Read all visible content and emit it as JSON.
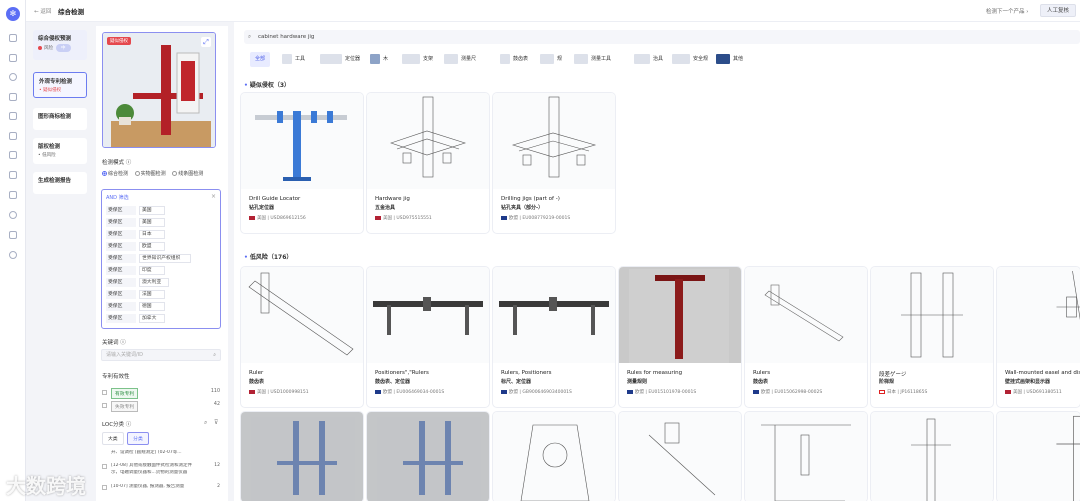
{
  "header": {
    "back_label": "← 返回",
    "title": "综合检测",
    "next_label": "检测下一个产品 ›",
    "manual_label": "人工复核"
  },
  "steps": [
    {
      "title": "综合侵权预测",
      "sub": "风险",
      "badge": "中"
    },
    {
      "title": "外观专利检测",
      "sub": "• 疑似侵权"
    },
    {
      "title": "图形商标检测",
      "sub": ""
    },
    {
      "title": "版权检测",
      "sub": "• 低风险"
    },
    {
      "title": "生成检测报告",
      "sub": ""
    }
  ],
  "panel": {
    "preview_tag": "疑似侵权",
    "mode_label": "检测模式 ⓘ",
    "modes": [
      "综合检测",
      "实物图检测",
      "线条图检测"
    ],
    "and_header": "AND 筛选",
    "filters": [
      {
        "k": "受保区",
        "v": "美国"
      },
      {
        "k": "受保区",
        "v": "美国"
      },
      {
        "k": "受保区",
        "v": "日本"
      },
      {
        "k": "受保区",
        "v": "欧盟"
      },
      {
        "k": "受保区",
        "v": "世界知识产权组织"
      },
      {
        "k": "受保区",
        "v": "印度"
      },
      {
        "k": "受保区",
        "v": "澳大利亚"
      },
      {
        "k": "受保区",
        "v": "法国"
      },
      {
        "k": "受保区",
        "v": "德国"
      },
      {
        "k": "受保区",
        "v": "加拿大"
      }
    ],
    "keyword_label": "关键词 ⓘ",
    "keyword_placeholder": "请输入关键词/ID",
    "status_label": "专利有效性",
    "status": [
      {
        "tag": "有效专利",
        "count": "110"
      },
      {
        "tag": "失效专利",
        "count": "42"
      }
    ],
    "loc_label": "LOC分类 ⓘ",
    "loc_tabs": [
      "大类",
      "分类"
    ],
    "loc_items": [
      {
        "text": "开、设调检 [圆规测定]  (02-07等...",
        "count": ""
      },
      {
        "text": "[12-08] 其他或接触面件式检测和测定件",
        "count": "12"
      },
      {
        "text": "示，电磁调量仪器和...货物的测量仪器",
        "count": ""
      },
      {
        "text": "[10-07] 测量仪器, 报测器, 报告测量",
        "count": "2"
      }
    ]
  },
  "main": {
    "search_value": "cabinet hardware jig",
    "categories": [
      "全部",
      "工具",
      "定位器",
      "木",
      "支架",
      "测量尺",
      "鼓齿表",
      "规",
      "测量工具",
      "治具",
      "安全规",
      "其他"
    ],
    "section1": "疑似侵权（3）",
    "section2": "低风险（176）",
    "results_suspect": [
      {
        "name": "Drill Guide Locator",
        "cn": "钻孔定位器",
        "region": "美国",
        "id": "USD869612156"
      },
      {
        "name": "Hardware jig",
        "cn": "五金治具",
        "region": "美国",
        "id": "USD975515551"
      },
      {
        "name": "Drilling jigs (part of -)",
        "cn": "钻孔夹具（部分-）",
        "region": "欧盟",
        "id": "EU008779219-0001S"
      }
    ],
    "results_low": [
      {
        "name": "Ruler",
        "cn": "鼓齿表",
        "region": "美国",
        "id": "USD1000998151"
      },
      {
        "name": "Positioners\",\"Rulers",
        "cn": "鼓齿表、定位器",
        "region": "欧盟",
        "id": "EU006469034-0001S"
      },
      {
        "name": "Rulers, Positioners",
        "cn": "标尺、定位器",
        "region": "欧盟",
        "id": "GB90064690340001S"
      },
      {
        "name": "Rules for measuring",
        "cn": "测量规则",
        "region": "欧盟",
        "id": "EU015101978-0001S"
      },
      {
        "name": "Rulers",
        "cn": "鼓齿表",
        "region": "欧盟",
        "id": "EU015062998-0002S"
      },
      {
        "name": "段差ゲージ",
        "cn": "阶梯规",
        "region": "日本",
        "id": "JP1611865S"
      },
      {
        "name": "Wall-mounted easel and display",
        "cn": "壁挂式画架和显示器",
        "region": "美国",
        "id": "USD691380511"
      }
    ]
  },
  "watermark": "大数跨境"
}
